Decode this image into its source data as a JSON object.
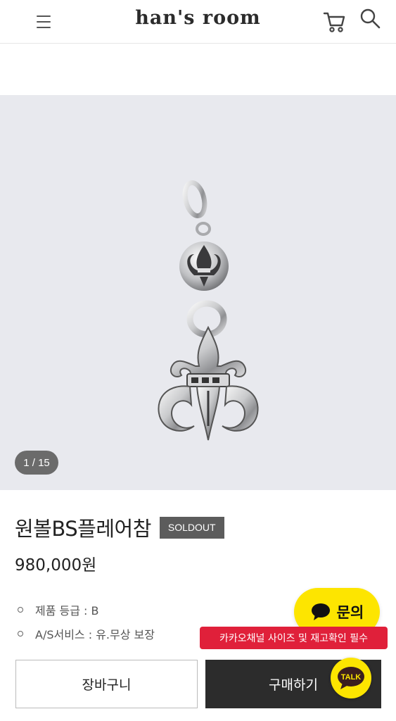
{
  "header": {
    "logo": "han's room",
    "menu_icon": "hamburger-menu-icon",
    "cart_icon": "shopping-cart-icon",
    "search_icon": "search-icon"
  },
  "gallery": {
    "counter": "1 / 15",
    "background": "#e8e9ee"
  },
  "product": {
    "name": "원볼BS플레어참",
    "status_badge": "SOLDOUT",
    "price": "980,000원",
    "specs": [
      {
        "label": "제품 등급 : B"
      },
      {
        "label": "A/S서비스 :  유.무상 보장"
      }
    ]
  },
  "floating": {
    "inquiry_label": "문의",
    "kakao_tooltip": "카카오채널 사이즈 및 재고확인 필수",
    "talk_label": "TALK"
  },
  "actions": {
    "cart_label": "장바구니",
    "buy_label": "구매하기"
  },
  "colors": {
    "kakao_yellow": "#fde500",
    "tooltip_red": "#e0203a",
    "buy_dark": "#2c2c2c",
    "badge_gray": "#5c5c5c"
  }
}
